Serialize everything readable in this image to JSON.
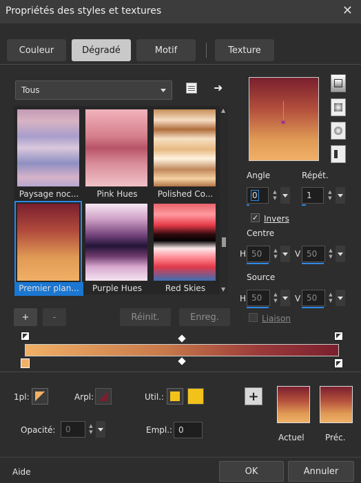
{
  "window": {
    "title": "Propriétés des styles et textures"
  },
  "tabs": [
    {
      "label": "Couleur"
    },
    {
      "label": "Dégradé"
    },
    {
      "label": "Motif"
    },
    {
      "label": "Texture"
    }
  ],
  "category": {
    "value": "Tous"
  },
  "gradients": [
    {
      "label": "Paysage noc..."
    },
    {
      "label": "Pink Hues"
    },
    {
      "label": "Polished Co..."
    },
    {
      "label": "Premier plan..."
    },
    {
      "label": "Purple Hues"
    },
    {
      "label": "Red Skies"
    }
  ],
  "gallery_buttons": {
    "add": "+",
    "remove": "-",
    "reset": "Réinit.",
    "save": "Enreg."
  },
  "settings": {
    "angle_label": "Angle",
    "angle_value": "0",
    "repeat_label": "Répét.",
    "repeat_value": "1",
    "invert_label": "Invers",
    "center_label": "Centre",
    "center_h": "50",
    "center_v": "50",
    "source_label": "Source",
    "source_h": "50",
    "source_v": "50",
    "h_label": "H",
    "v_label": "V",
    "link_label": "Liaison"
  },
  "lower": {
    "fg_label": "1pl:",
    "bg_label": "Arpl:",
    "user_label": "Util.:",
    "opacity_label": "Opacité:",
    "opacity_value": "0",
    "location_label": "Empl.:",
    "location_value": "0",
    "current_label": "Actuel",
    "previous_label": "Préc."
  },
  "footer": {
    "help": "Aide",
    "ok": "OK",
    "cancel": "Annuler"
  },
  "colors": {
    "accent": "#2d8ae8",
    "user_color": "#f2c21a",
    "gradient_start": "#f0b066",
    "gradient_end": "#7a1f2e"
  }
}
